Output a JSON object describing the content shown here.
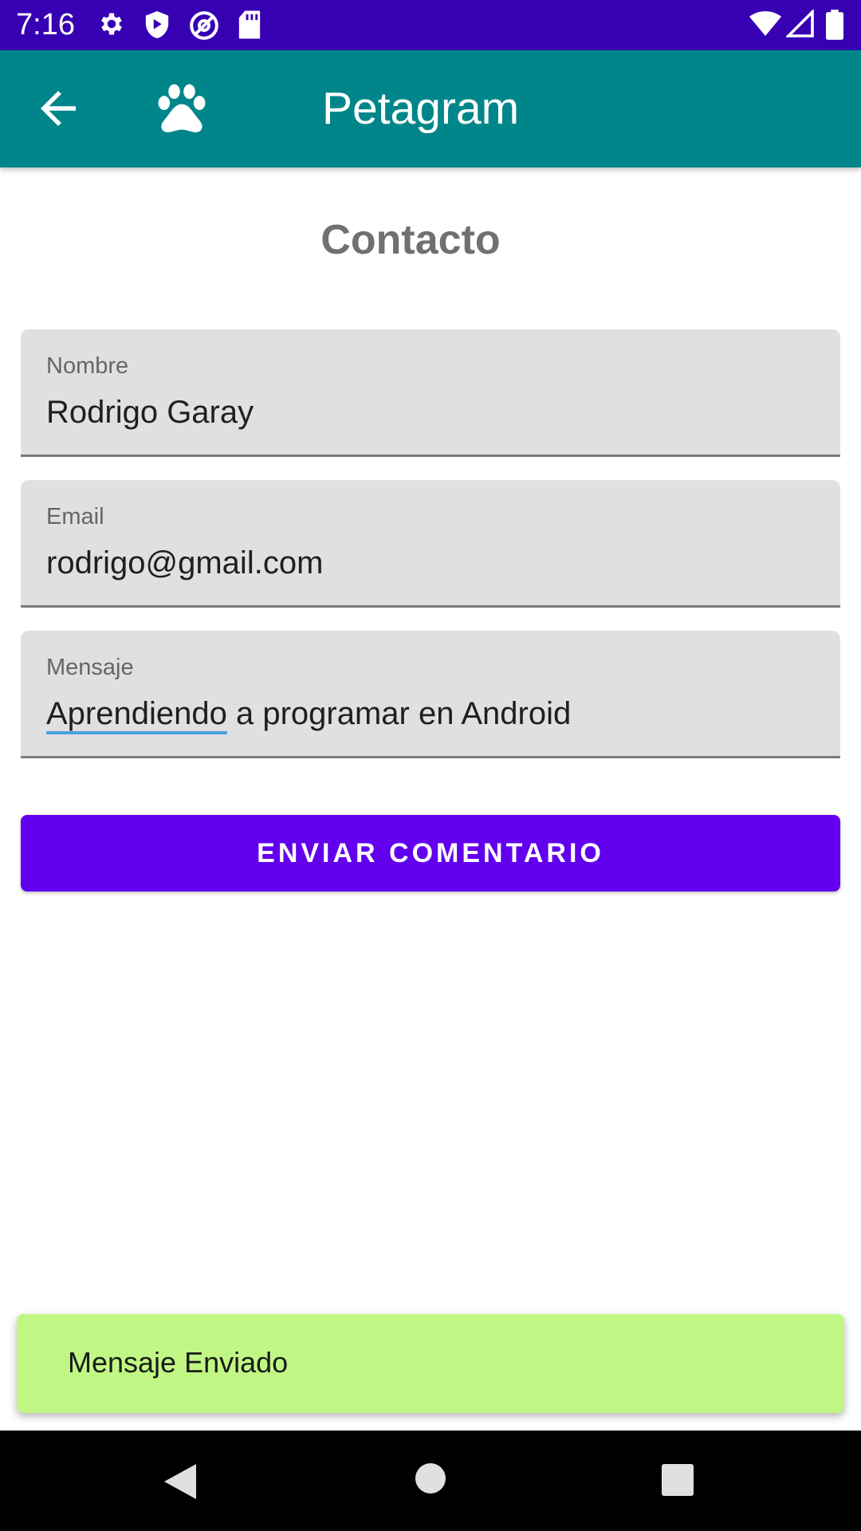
{
  "status_bar": {
    "time": "7:16",
    "icons_left": [
      "settings-icon",
      "play-protect-icon",
      "at-sign-icon",
      "sd-card-icon"
    ],
    "icons_right": [
      "wifi-icon",
      "cell-signal-icon",
      "battery-icon"
    ],
    "background": "#3700b3"
  },
  "app_bar": {
    "title": "Petagram",
    "back_icon": "arrow-back-icon",
    "logo_icon": "paw-icon",
    "background": "#00868a"
  },
  "page": {
    "title": "Contacto"
  },
  "form": {
    "nombre": {
      "label": "Nombre",
      "value": "Rodrigo Garay"
    },
    "email": {
      "label": "Email",
      "value": "rodrigo@gmail.com"
    },
    "mensaje": {
      "label": "Mensaje",
      "value_underlined": "Aprendiendo",
      "value_rest": " a programar en Android"
    }
  },
  "button": {
    "label": "ENVIAR COMENTARIO",
    "color": "#6200ee"
  },
  "snackbar": {
    "text": "Mensaje Enviado",
    "color": "#c0f784"
  },
  "nav_bar": {
    "icons": [
      "nav-back-icon",
      "nav-home-icon",
      "nav-recents-icon"
    ]
  }
}
